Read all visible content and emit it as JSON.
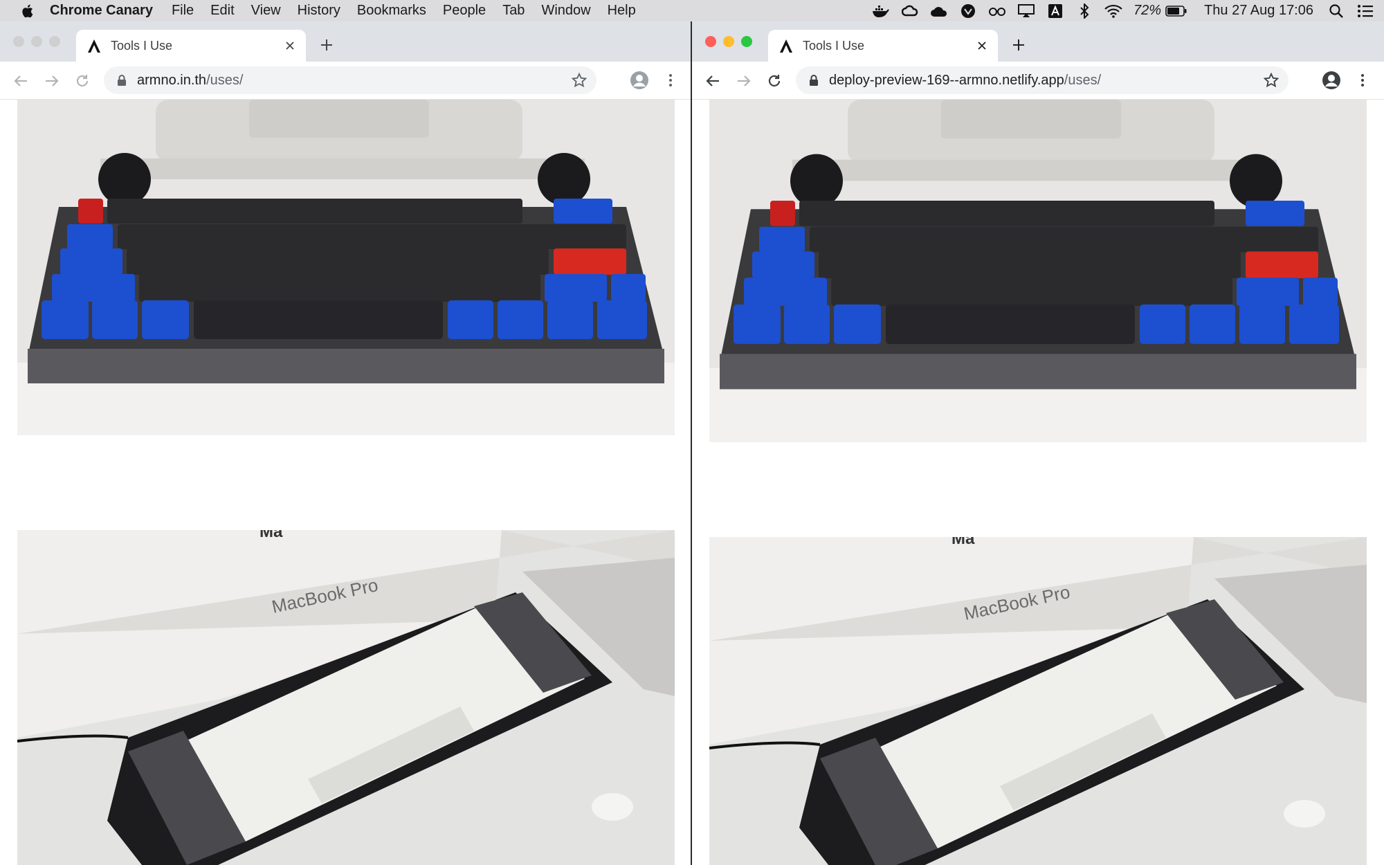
{
  "menubar": {
    "app_name": "Chrome Canary",
    "items": [
      "File",
      "Edit",
      "View",
      "History",
      "Bookmarks",
      "People",
      "Tab",
      "Window",
      "Help"
    ],
    "battery": "72%",
    "clock": "Thu 27 Aug  17:06",
    "status_icons": [
      "docker-icon",
      "creative-cloud-icon",
      "cloud-icon",
      "shield-icon",
      "glasses-icon",
      "airplay-icon",
      "input-source-icon",
      "bluetooth-icon",
      "wifi-icon",
      "battery-icon",
      "spotlight-icon",
      "control-center-icon"
    ]
  },
  "left_window": {
    "tab_title": "Tools I Use",
    "url_host": "armno.in.th",
    "url_path": "/uses/",
    "active": false
  },
  "right_window": {
    "tab_title": "Tools I Use",
    "url_host": "deploy-preview-169--armno.netlify.app",
    "url_path": "/uses/",
    "active": true
  },
  "photos": {
    "top": "blue and black mechanical keyboard",
    "bottom": "white and grey mechanical keyboard in front of MacBook Pro box",
    "box_label": "MacBook Pro",
    "box_label_partial": "Ma"
  },
  "colors": {
    "menubar": "#dcdcde",
    "tabstrip": "#dee1e6",
    "close": "#fe5f57",
    "minimize": "#febc2e",
    "zoom": "#28c840",
    "inactive_traffic": "#cfcfcf"
  }
}
